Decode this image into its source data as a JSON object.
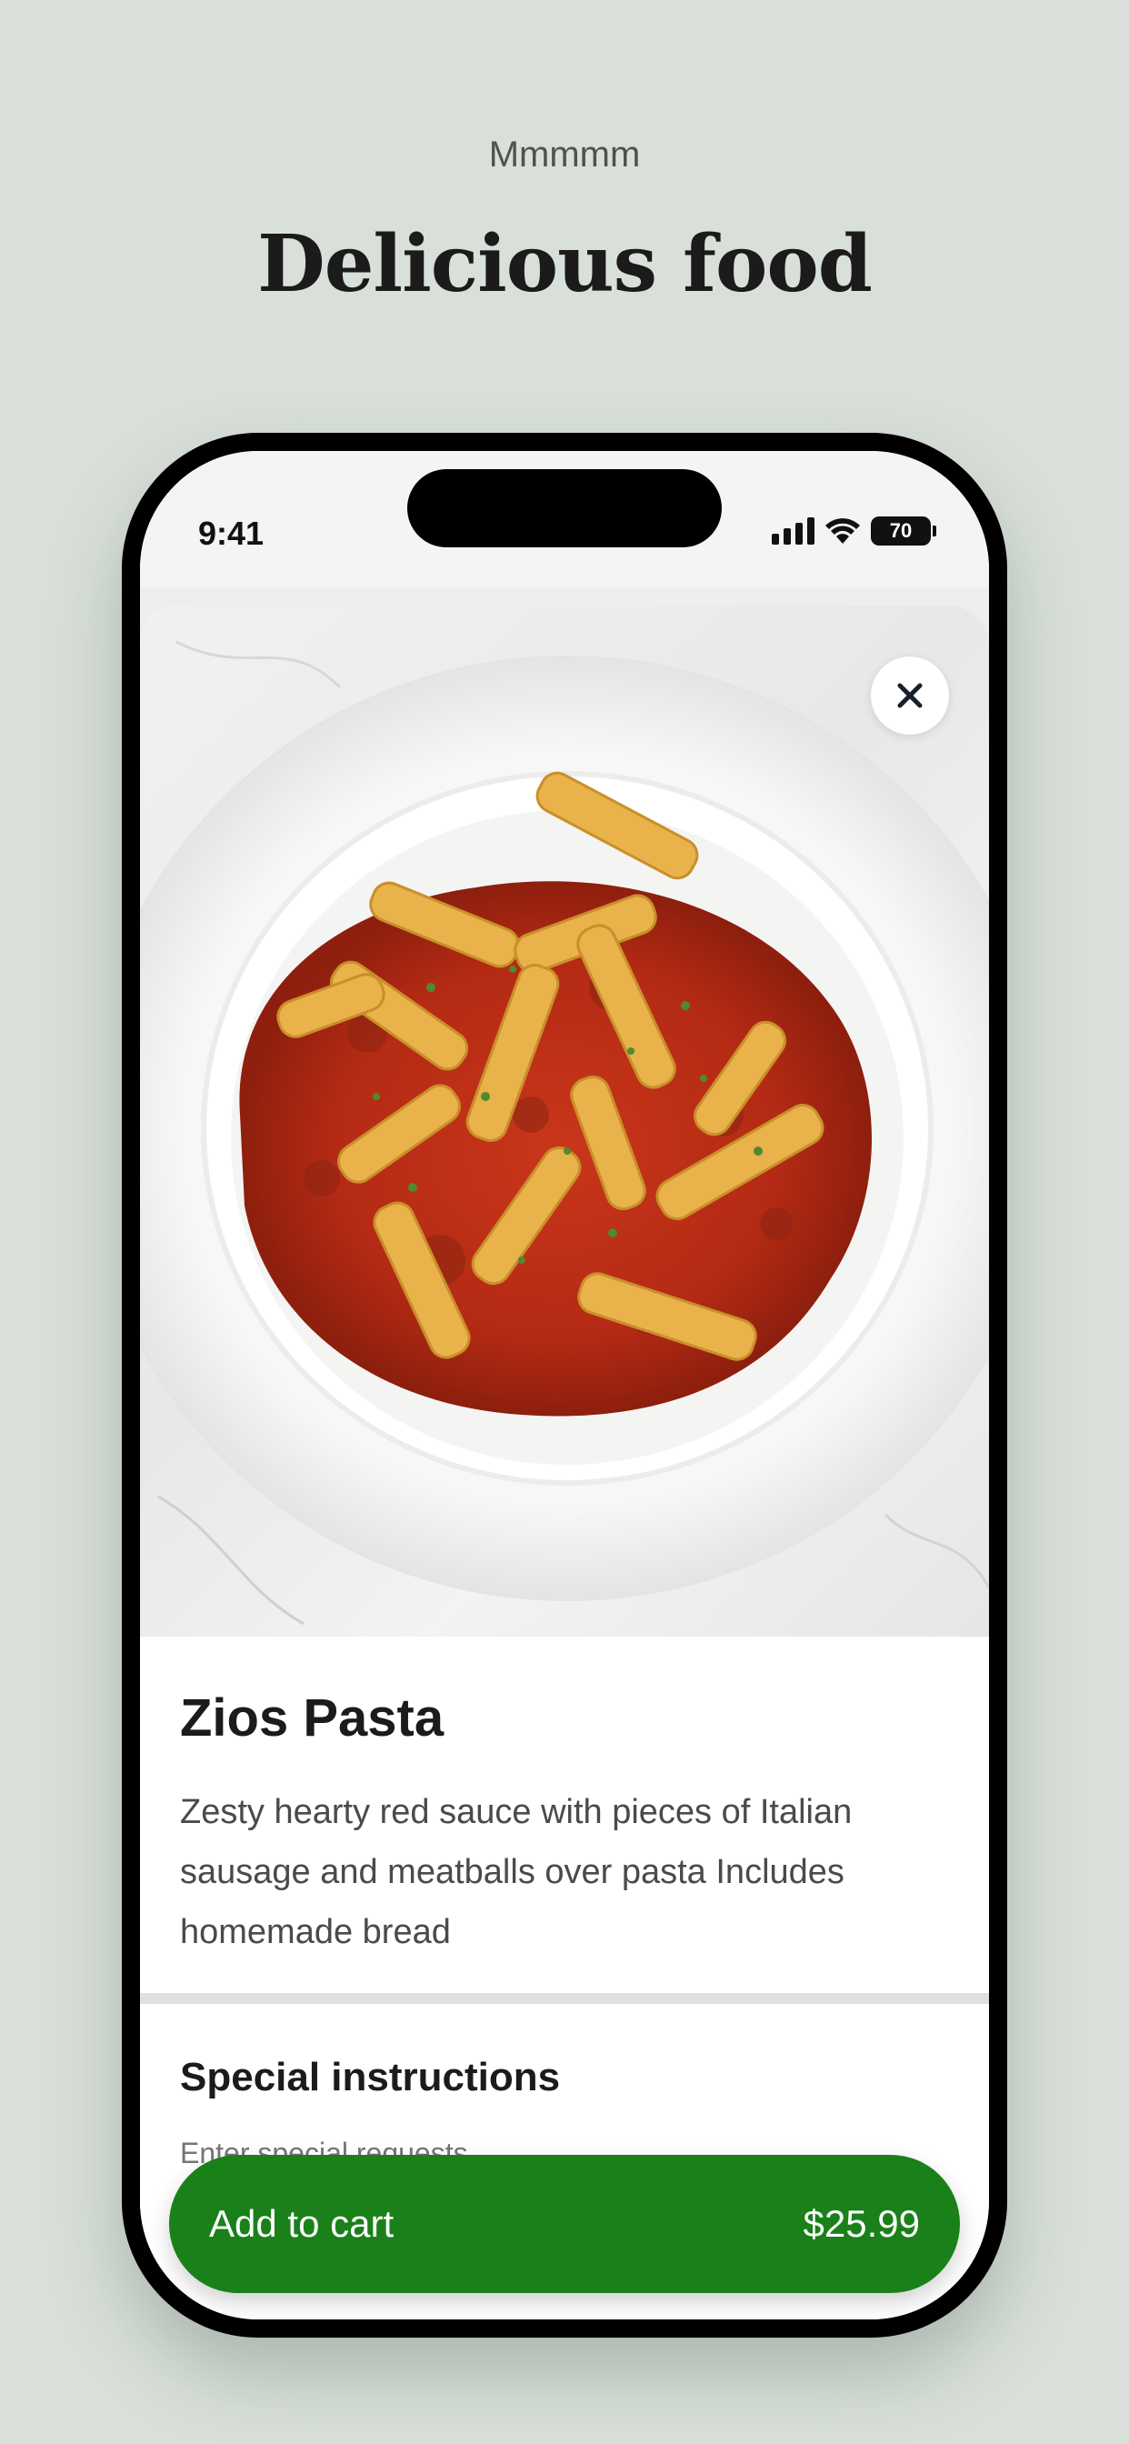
{
  "hero": {
    "subtitle": "Mmmmm",
    "title": "Delicious food"
  },
  "status_bar": {
    "time": "9:41",
    "battery": "70",
    "icons": [
      "signal-icon",
      "wifi-icon",
      "battery-icon"
    ]
  },
  "item": {
    "image_alt": "plate of penne pasta in red meat sauce",
    "name": "Zios Pasta",
    "description": "Zesty hearty red sauce with pieces of Italian sausage and meatballs over pasta Includes homemade bread"
  },
  "special_instructions": {
    "title": "Special instructions",
    "placeholder": "Enter special requests"
  },
  "cart_button": {
    "label": "Add to cart",
    "price": "$25.99"
  },
  "colors": {
    "background": "#d9e0da",
    "accent_green": "#1a8019",
    "divider": "#dde2dd"
  }
}
